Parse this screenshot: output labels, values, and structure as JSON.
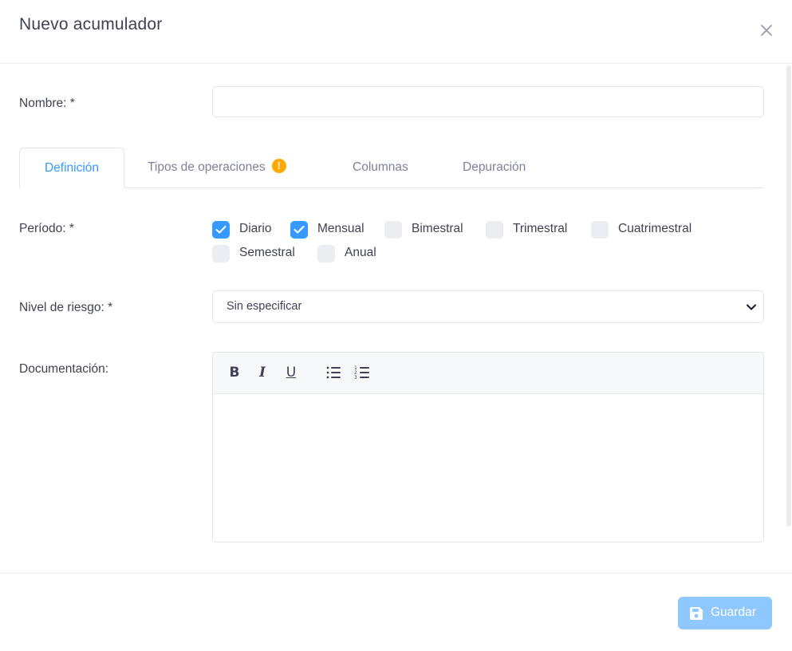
{
  "dialog": {
    "title": "Nuevo acumulador",
    "close_icon": "close-icon"
  },
  "form": {
    "name_label": "Nombre: *",
    "name_value": "",
    "name_placeholder": ""
  },
  "tabs": [
    {
      "label": "Definición",
      "active": true
    },
    {
      "label": "Tipos de operaciones",
      "active": false,
      "badge_icon": "warning-icon",
      "badge_text": "!"
    },
    {
      "label": "Columnas",
      "active": false
    },
    {
      "label": "Depuración",
      "active": false
    }
  ],
  "period": {
    "label": "Período: *",
    "options": [
      {
        "label": "Diario",
        "checked": true
      },
      {
        "label": "Mensual",
        "checked": true
      },
      {
        "label": "Bimestral",
        "checked": false
      },
      {
        "label": "Trimestral",
        "checked": false
      },
      {
        "label": "Cuatrimestral",
        "checked": false
      },
      {
        "label": "Semestral",
        "checked": false
      },
      {
        "label": "Anual",
        "checked": false
      }
    ]
  },
  "risk": {
    "label": "Nivel de riesgo: *",
    "selected": "Sin especificar"
  },
  "documentation": {
    "label": "Documentación:",
    "content": "",
    "toolbar": {
      "bold": "B",
      "italic": "I",
      "underline": "U",
      "bullet_list_icon": "bullet-list-icon",
      "numbered_list_icon": "numbered-list-icon"
    }
  },
  "footer": {
    "save_label": "Guardar",
    "save_icon": "floppy-disk-icon"
  },
  "colors": {
    "accent": "#3699ff",
    "save_button": "#8fc7ff",
    "warning": "#ffa800",
    "text": "#3f4254",
    "muted": "#7e8299"
  }
}
